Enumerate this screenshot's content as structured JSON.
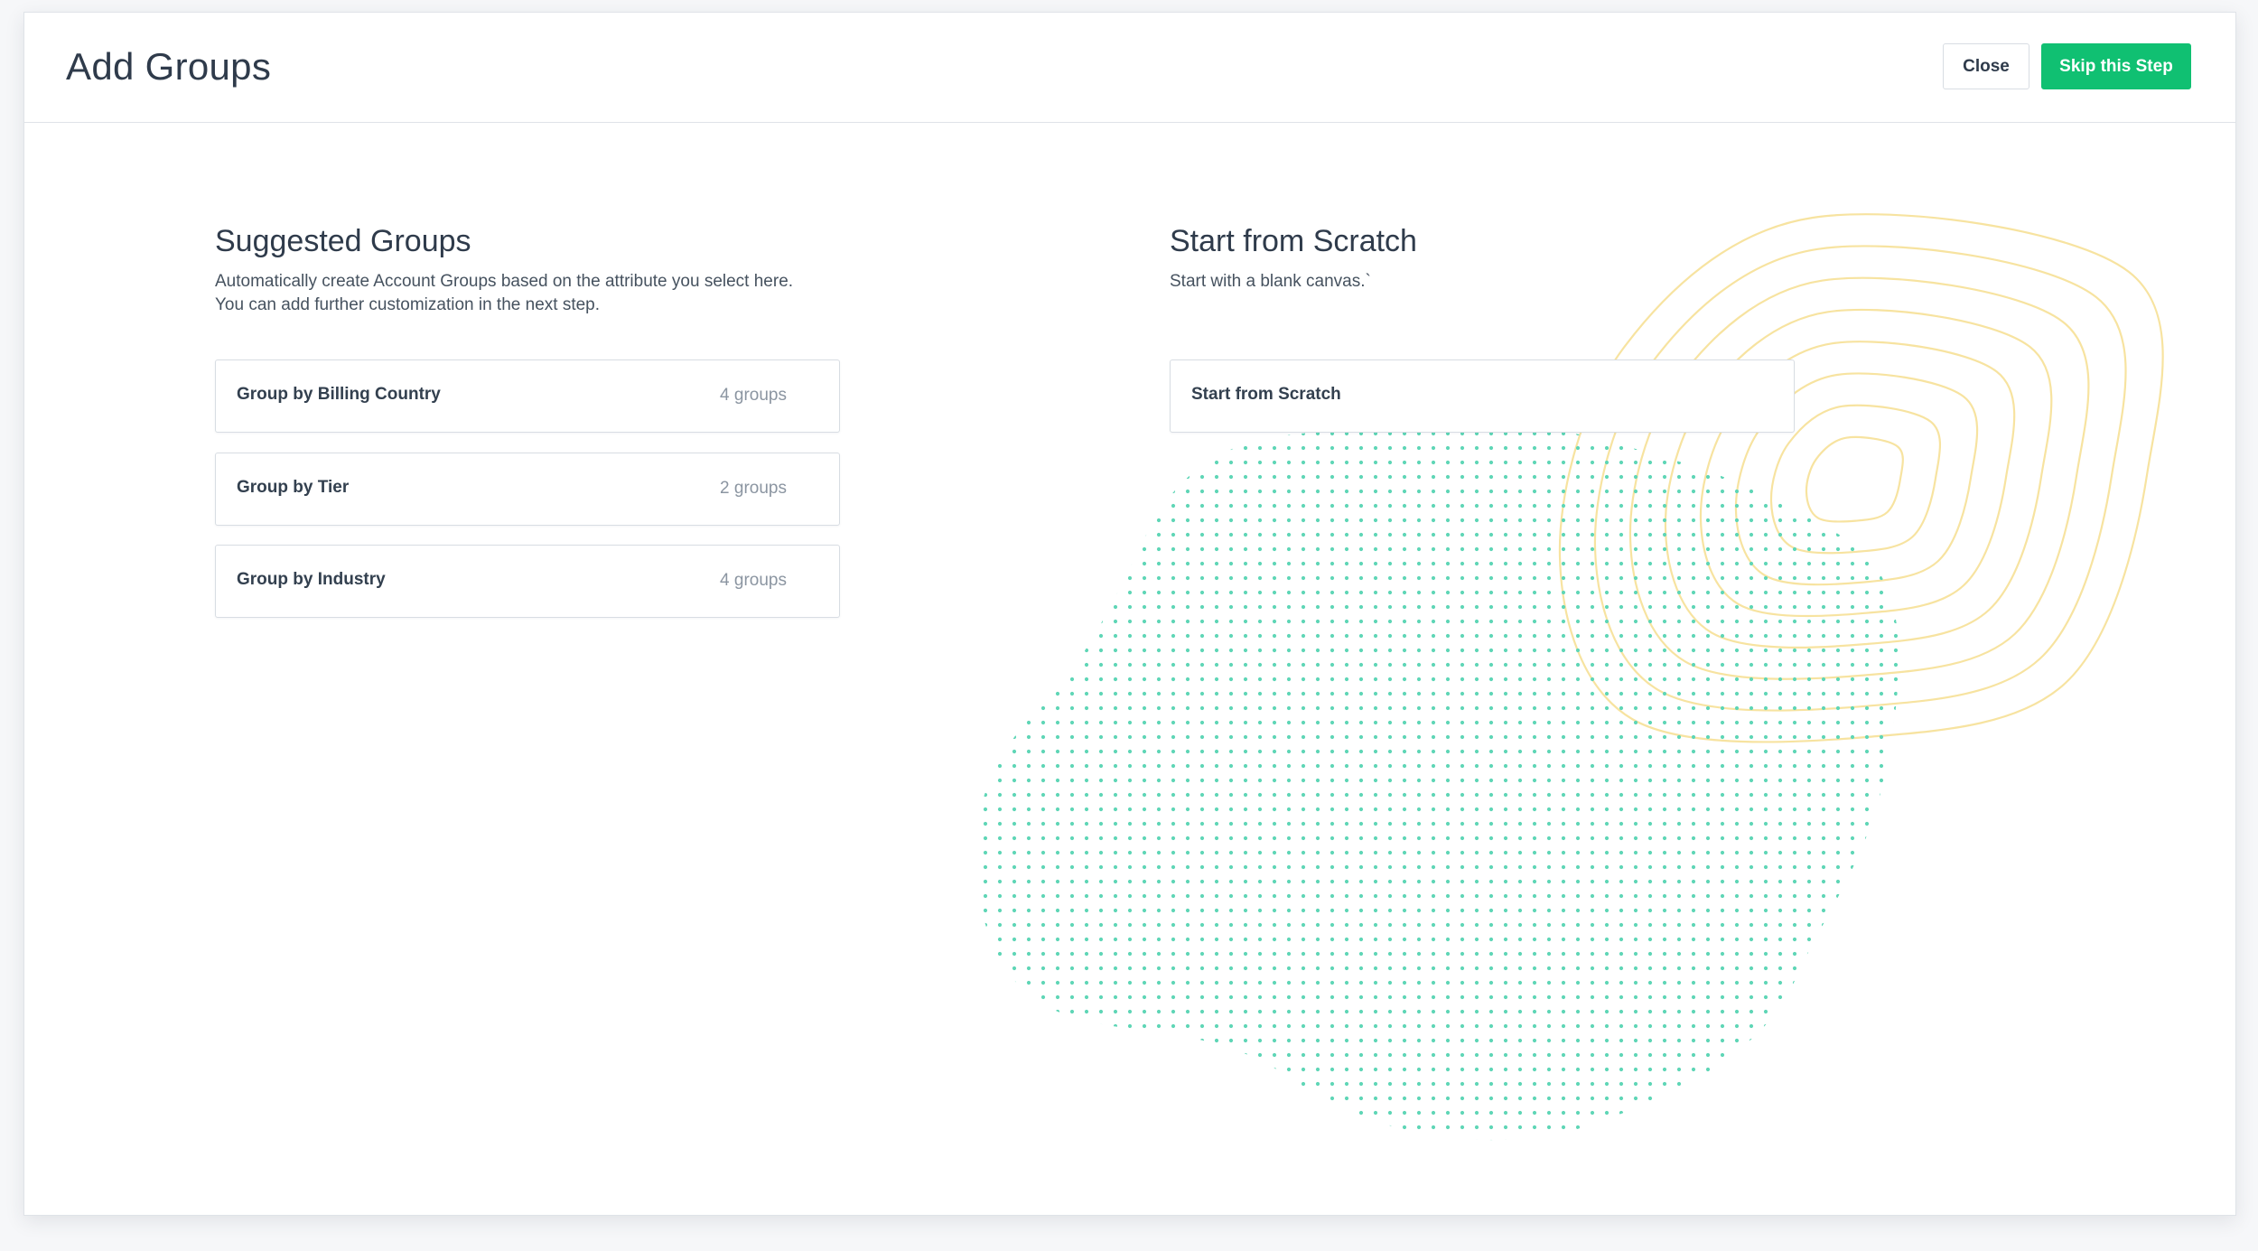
{
  "header": {
    "title": "Add Groups",
    "close_label": "Close",
    "skip_label": "Skip this Step"
  },
  "suggested": {
    "title": "Suggested Groups",
    "description_line1": "Automatically create Account Groups based on the attribute you select here.",
    "description_line2": "You can add further customization in the next step.",
    "options": [
      {
        "label": "Group by Billing Country",
        "count": "4 groups"
      },
      {
        "label": "Group by Tier",
        "count": "2 groups"
      },
      {
        "label": "Group by Industry",
        "count": "4 groups"
      }
    ]
  },
  "scratch": {
    "title": "Start from Scratch",
    "description": "Start with a blank canvas.`",
    "button_label": "Start from Scratch"
  },
  "colors": {
    "primary": "#10c072",
    "dots": "#5fd6b6",
    "contours": "#f7e3a0",
    "text": "#2f3b4b",
    "muted": "#8b95a1",
    "border": "#d8dde3"
  }
}
